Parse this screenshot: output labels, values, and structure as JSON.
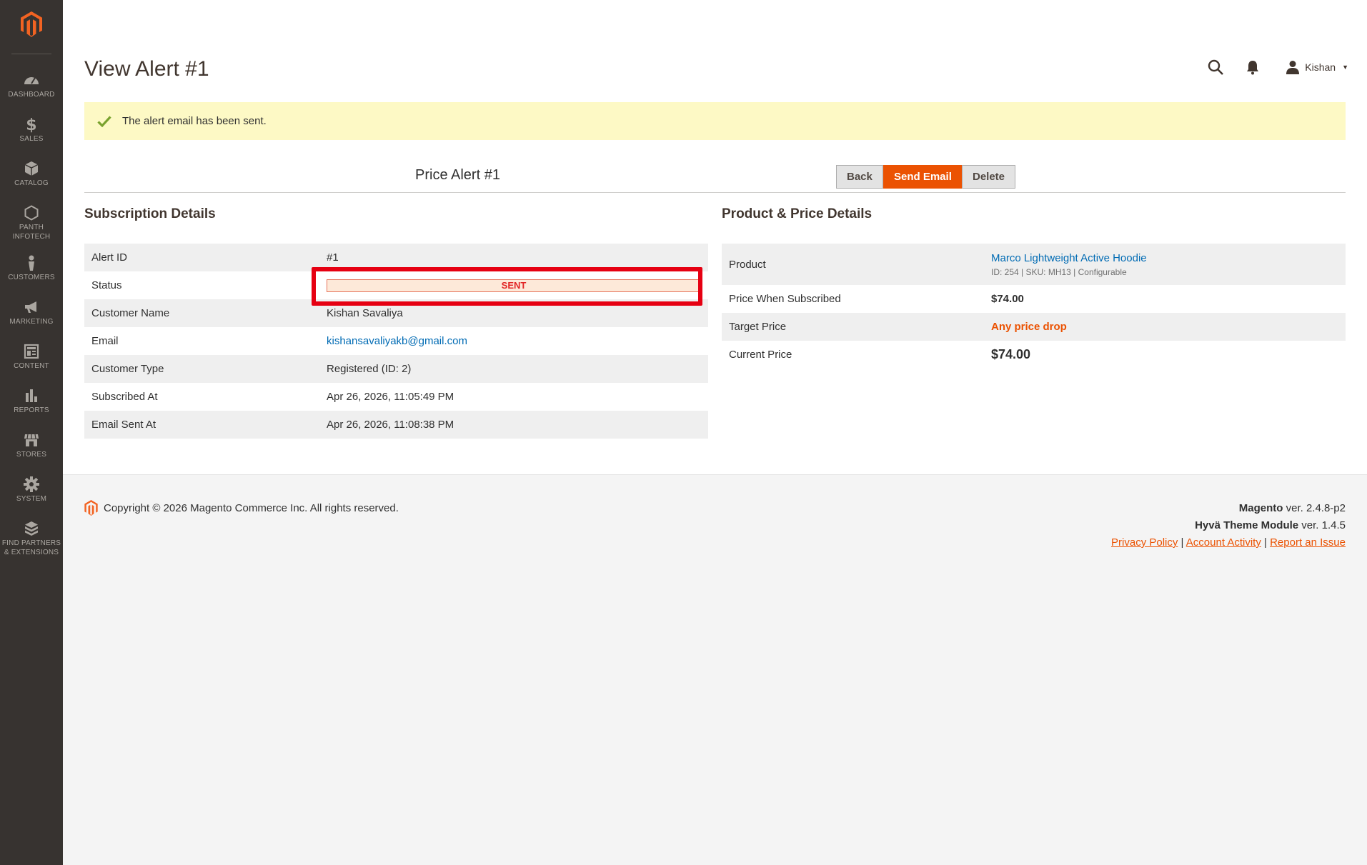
{
  "sidebar": {
    "items": [
      {
        "label": "DASHBOARD",
        "icon": "dashboard-icon"
      },
      {
        "label": "SALES",
        "icon": "dollar-icon"
      },
      {
        "label": "CATALOG",
        "icon": "box-icon"
      },
      {
        "label_line1": "PANTH",
        "label_line2": "INFOTECH",
        "icon": "hexagon-icon"
      },
      {
        "label": "CUSTOMERS",
        "icon": "person-icon"
      },
      {
        "label": "MARKETING",
        "icon": "megaphone-icon"
      },
      {
        "label": "CONTENT",
        "icon": "layout-icon"
      },
      {
        "label": "REPORTS",
        "icon": "bar-chart-icon"
      },
      {
        "label": "STORES",
        "icon": "storefront-icon"
      },
      {
        "label": "SYSTEM",
        "icon": "gear-icon"
      },
      {
        "label_line1": "FIND PARTNERS",
        "label_line2": "& EXTENSIONS",
        "icon": "blocks-icon"
      }
    ]
  },
  "header": {
    "title": "View Alert #1",
    "user": "Kishan"
  },
  "message": {
    "text": "The alert email has been sent."
  },
  "toolbar": {
    "title": "Price Alert #1",
    "back_label": "Back",
    "send_label": "Send Email",
    "delete_label": "Delete"
  },
  "subscription": {
    "title": "Subscription Details",
    "alert_id_label": "Alert ID",
    "alert_id": "#1",
    "status_label": "Status",
    "status": "SENT",
    "customer_name_label": "Customer Name",
    "customer_name": "Kishan Savaliya",
    "email_label": "Email",
    "email": "kishansavaliyakb@gmail.com",
    "customer_type_label": "Customer Type",
    "customer_type": "Registered (ID: 2)",
    "subscribed_at_label": "Subscribed At",
    "subscribed_at": "Apr 26, 2026, 11:05:49 PM",
    "email_sent_at_label": "Email Sent At",
    "email_sent_at": "Apr 26, 2026, 11:08:38 PM"
  },
  "product": {
    "title": "Product & Price Details",
    "product_label": "Product",
    "product_name": "Marco Lightweight Active Hoodie",
    "product_meta": "ID: 254 | SKU: MH13 | Configurable",
    "price_subscribed_label": "Price When Subscribed",
    "price_subscribed": "$74.00",
    "target_price_label": "Target Price",
    "target_price": "Any price drop",
    "current_price_label": "Current Price",
    "current_price": "$74.00"
  },
  "footer": {
    "copyright": "Copyright © 2026 Magento Commerce Inc. All rights reserved.",
    "magento_name": "Magento",
    "magento_ver": " ver. 2.4.8-p2",
    "hyva_name": "Hyvä Theme Module",
    "hyva_ver": " ver. 1.4.5",
    "privacy_label": "Privacy Policy",
    "activity_label": " Account Activity",
    "report_label": "Report an Issue"
  },
  "colors": {
    "accent": "#eb5202",
    "sidebar": "#373330",
    "link": "#006bb4",
    "message_bg": "#fdf9c5",
    "highlight": "#e60012"
  }
}
